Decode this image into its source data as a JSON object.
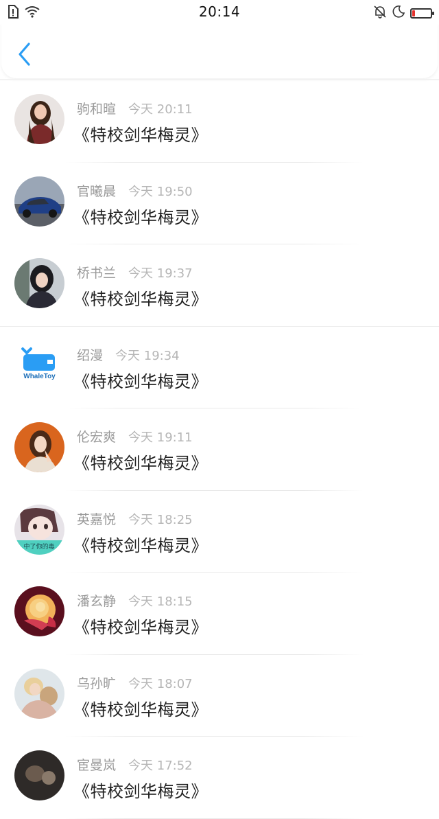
{
  "status_bar": {
    "time": "20:14",
    "left_icons": [
      "sim-alert-icon",
      "wifi-icon"
    ],
    "right_icons": [
      "bell-muted-icon",
      "moon-icon",
      "battery-icon"
    ],
    "battery_level": 0.15,
    "battery_color": "#e5322d"
  },
  "header": {
    "back_icon": "chevron-left-icon",
    "accent": "#2a9df4"
  },
  "items": [
    {
      "name": "驹和暄",
      "time": "今天 20:11",
      "message": "《特校剑华梅灵》",
      "avatar": "woman-red-dress"
    },
    {
      "name": "官曦晨",
      "time": "今天 19:50",
      "message": "《特校剑华梅灵》",
      "avatar": "blue-car"
    },
    {
      "name": "桥书兰",
      "time": "今天 19:37",
      "message": "《特校剑华梅灵》",
      "avatar": "girl-dark-hair"
    },
    {
      "name": "绍漫",
      "time": "今天 19:34",
      "message": "《特校剑华梅灵》",
      "avatar": "whaletoy-logo",
      "avatar_text": "WhaleToy"
    },
    {
      "name": "伦宏爽",
      "time": "今天 19:11",
      "message": "《特校剑华梅灵》",
      "avatar": "girl-orange-bg"
    },
    {
      "name": "英嘉悦",
      "time": "今天 18:25",
      "message": "《特校剑华梅灵》",
      "avatar": "cartoon-face",
      "avatar_text": "中了你的毒"
    },
    {
      "name": "潘玄静",
      "time": "今天 18:15",
      "message": "《特校剑华梅灵》",
      "avatar": "yellow-rose"
    },
    {
      "name": "乌孙旷",
      "time": "今天 18:07",
      "message": "《特校剑华梅灵》",
      "avatar": "couple-photo"
    },
    {
      "name": "宦曼岚",
      "time": "今天 17:52",
      "message": "《特校剑华梅灵》",
      "avatar": "dark-photo"
    }
  ]
}
